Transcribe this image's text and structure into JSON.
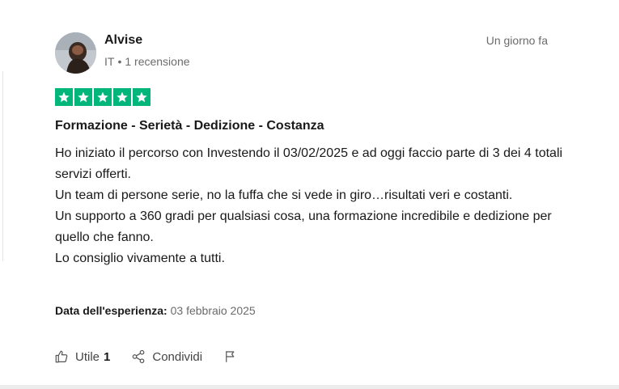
{
  "reviewer": {
    "name": "Alvise",
    "country": "IT",
    "separator": "•",
    "reviews_count": "1 recensione"
  },
  "review": {
    "relative_date": "Un giorno fa",
    "rating": 5,
    "rating_max": 5,
    "star_color": "#00b67a",
    "title": "Formazione - Serietà - Dedizione - Costanza",
    "body_lines": [
      "Ho iniziato il percorso con Investendo il 03/02/2025 e ad oggi faccio parte di 3 dei 4 totali servizi offerti.",
      "Un team di persone serie, no la fuffa che si vede in giro…risultati veri e costanti.",
      "Un supporto a 360 gradi per qualsiasi cosa, una formazione incredibile e dedizione per quello che fanno.",
      "Lo consiglio vivamente a tutti."
    ],
    "experience_label": "Data dell'esperienza:",
    "experience_date": "03 febbraio 2025"
  },
  "actions": {
    "useful_label": "Utile",
    "useful_count": "1",
    "share_label": "Condividi",
    "icons": [
      "thumbs-up-icon",
      "share-icon",
      "flag-icon"
    ]
  }
}
